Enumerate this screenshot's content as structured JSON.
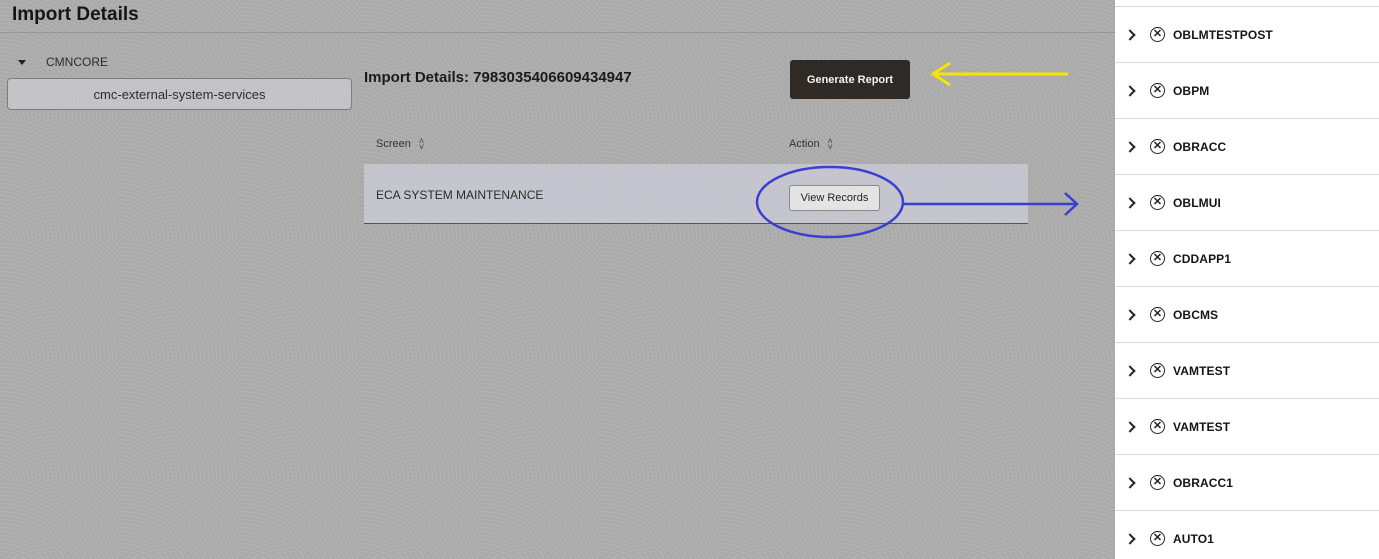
{
  "page": {
    "title": "Import Details"
  },
  "tree": {
    "root_label": "CMNCORE",
    "child_label": "cmc-external-system-services"
  },
  "details": {
    "heading": "Import Details: 7983035406609434947",
    "generate_report_label": "Generate Report"
  },
  "table": {
    "columns": [
      "Screen",
      "Action"
    ],
    "rows": [
      {
        "screen": "ECA SYSTEM MAINTENANCE",
        "action_label": "View Records"
      }
    ]
  },
  "panel": {
    "items": [
      {
        "label": "OBLMTESTPOST"
      },
      {
        "label": "OBPM"
      },
      {
        "label": "OBRACC"
      },
      {
        "label": "OBLMUI"
      },
      {
        "label": "CDDAPP1"
      },
      {
        "label": "OBCMS"
      },
      {
        "label": "VAMTEST"
      },
      {
        "label": "VAMTEST"
      },
      {
        "label": "OBRACC1"
      },
      {
        "label": "AUTO1"
      }
    ]
  },
  "annotations": {
    "yellow_arrow_color": "#f5e600",
    "blue_annotation_color": "#3a3fd1"
  }
}
